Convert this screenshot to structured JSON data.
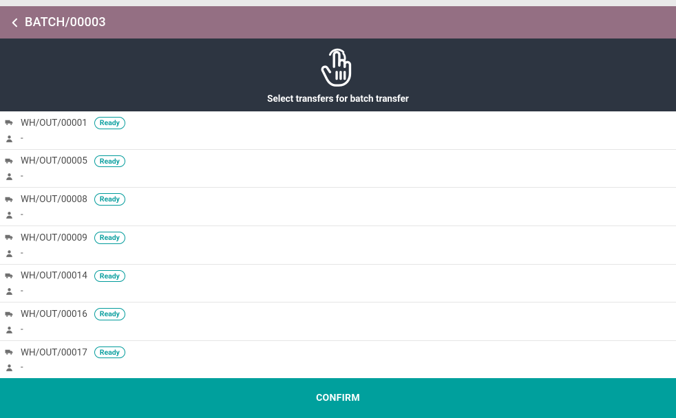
{
  "header": {
    "title": "BATCH/00003"
  },
  "banner": {
    "instruction": "Select transfers for batch transfer"
  },
  "transfers": [
    {
      "name": "WH/OUT/00001",
      "status": "Ready",
      "partner": "-"
    },
    {
      "name": "WH/OUT/00005",
      "status": "Ready",
      "partner": "-"
    },
    {
      "name": "WH/OUT/00008",
      "status": "Ready",
      "partner": "-"
    },
    {
      "name": "WH/OUT/00009",
      "status": "Ready",
      "partner": "-"
    },
    {
      "name": "WH/OUT/00014",
      "status": "Ready",
      "partner": "-"
    },
    {
      "name": "WH/OUT/00016",
      "status": "Ready",
      "partner": "-"
    },
    {
      "name": "WH/OUT/00017",
      "status": "Ready",
      "partner": "-"
    }
  ],
  "confirm": {
    "label": "CONFIRM"
  }
}
